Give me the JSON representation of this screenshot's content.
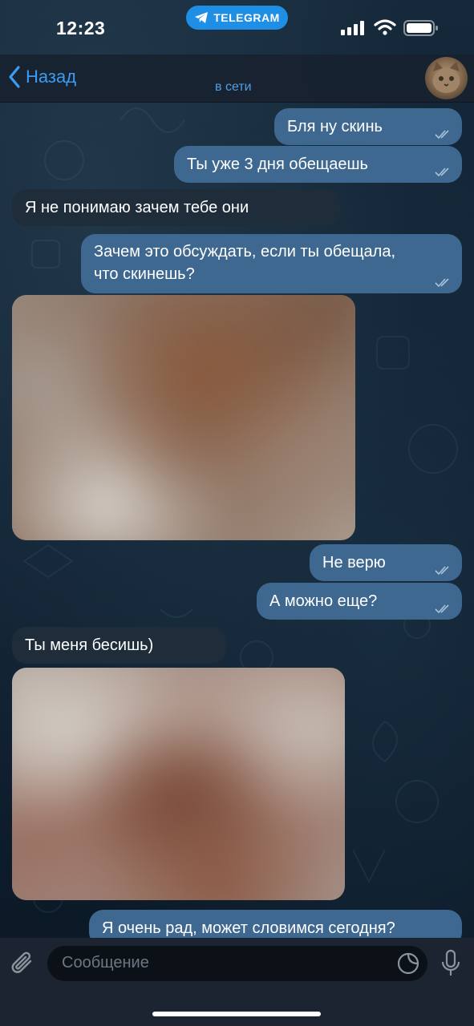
{
  "status_bar": {
    "time": "12:23",
    "app_pill": "TELEGRAM"
  },
  "header": {
    "back_label": "Назад",
    "status": "в сети"
  },
  "messages": [
    {
      "direction": "out",
      "text": "Бля ну скинь"
    },
    {
      "direction": "out",
      "text": "Ты уже 3 дня обещаешь"
    },
    {
      "direction": "in",
      "text": "Я не понимаю зачем тебе они"
    },
    {
      "direction": "out",
      "text": "Зачем это обсуждать, если ты обещала,",
      "text2": "что скинешь?"
    },
    {
      "direction": "in",
      "type": "photo"
    },
    {
      "direction": "out",
      "text": "Не верю"
    },
    {
      "direction": "out",
      "text": "А можно еще?"
    },
    {
      "direction": "in",
      "text": "Ты меня бесишь)"
    },
    {
      "direction": "in",
      "type": "photo"
    },
    {
      "direction": "out",
      "text": "Я очень рад, может словимся сегодня?"
    }
  ],
  "input": {
    "placeholder": "Сообщение"
  },
  "colors": {
    "outgoing_bubble": "#3e6890",
    "incoming_bubble": "#1f2c3a",
    "accent": "#3b9cf2"
  }
}
